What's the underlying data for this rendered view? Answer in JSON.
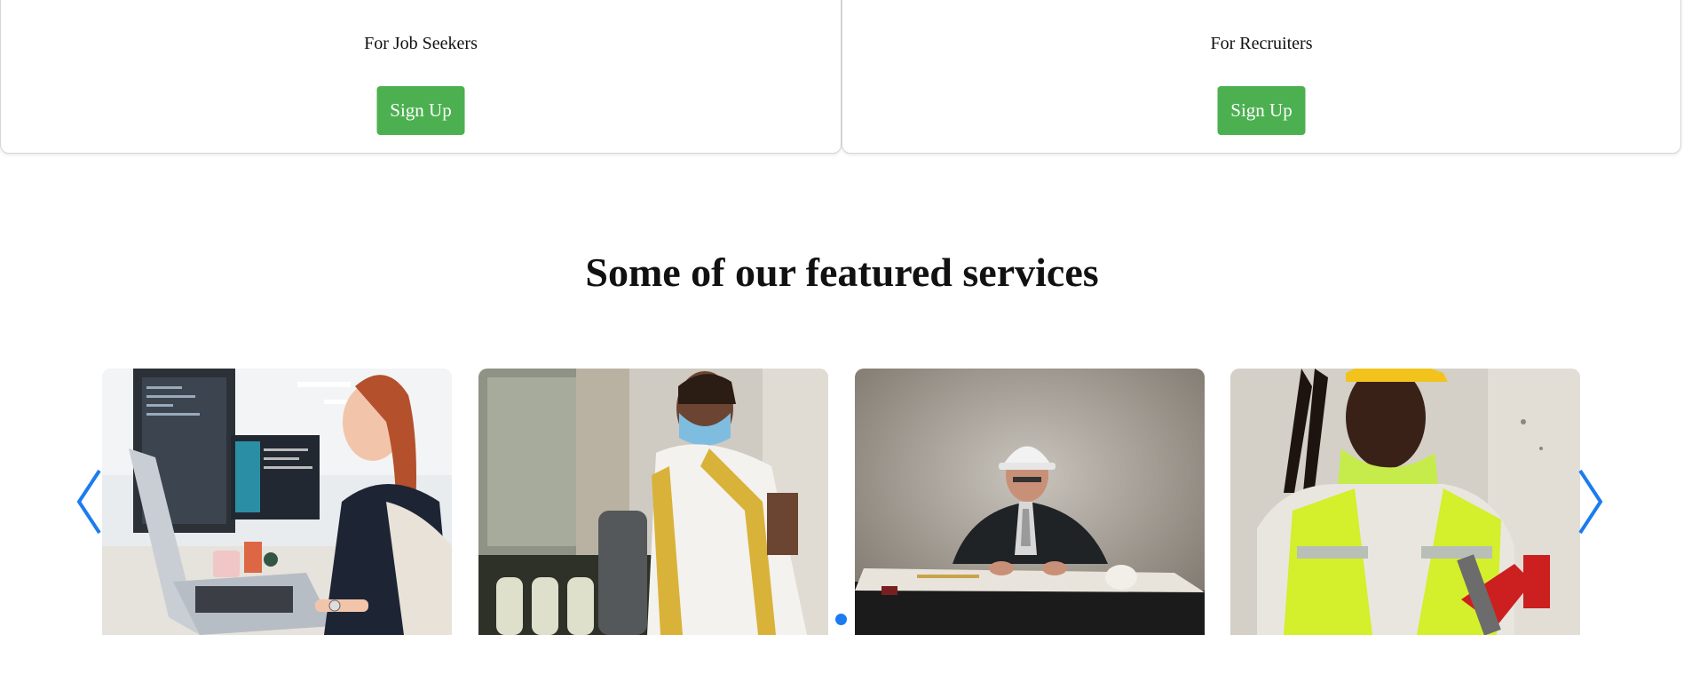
{
  "signup": {
    "job_seekers": {
      "title": "For Job Seekers",
      "button_label": "Sign Up"
    },
    "recruiters": {
      "title": "For Recruiters",
      "button_label": "Sign Up"
    }
  },
  "featured": {
    "heading": "Some of our featured services"
  },
  "carousel": {
    "slides": [
      {
        "image": "woman-at-computer-office-photo"
      },
      {
        "image": "woman-with-mask-photo"
      },
      {
        "image": "man-with-hard-hat-drafting-photo"
      },
      {
        "image": "construction-worker-safety-vest-photo"
      }
    ],
    "active_dot": 1,
    "accent_color": "#1b7cf0",
    "button_color": "#4cb050"
  }
}
